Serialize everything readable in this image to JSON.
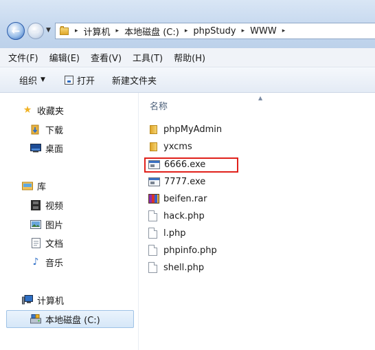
{
  "address": {
    "crumbs": [
      "计算机",
      "本地磁盘 (C:)",
      "phpStudy",
      "WWW"
    ],
    "sep": "▸"
  },
  "menu": {
    "items": [
      "文件(F)",
      "编辑(E)",
      "查看(V)",
      "工具(T)",
      "帮助(H)"
    ]
  },
  "toolbar": {
    "organize_label": "组织",
    "open_label": "打开",
    "newfolder_label": "新建文件夹"
  },
  "nav": {
    "favorites": "收藏夹",
    "downloads": "下载",
    "desktop": "桌面",
    "libraries": "库",
    "videos": "视频",
    "pictures": "图片",
    "documents": "文档",
    "music": "音乐",
    "computer": "计算机",
    "local_disk": "本地磁盘 (C:)"
  },
  "files": {
    "column_name": "名称",
    "items": [
      {
        "name": "phpMyAdmin",
        "icon": "folder-icon"
      },
      {
        "name": "yxcms",
        "icon": "folder-icon"
      },
      {
        "name": "6666.exe",
        "icon": "exe-icon"
      },
      {
        "name": "7777.exe",
        "icon": "exe-icon"
      },
      {
        "name": "beifen.rar",
        "icon": "rar-icon"
      },
      {
        "name": "hack.php",
        "icon": "php-file-icon"
      },
      {
        "name": "l.php",
        "icon": "php-file-icon"
      },
      {
        "name": "phpinfo.php",
        "icon": "php-file-icon"
      },
      {
        "name": "shell.php",
        "icon": "php-file-icon"
      }
    ]
  },
  "colors": {
    "highlight": "#e0201a",
    "selection": "#d6e7f8"
  }
}
